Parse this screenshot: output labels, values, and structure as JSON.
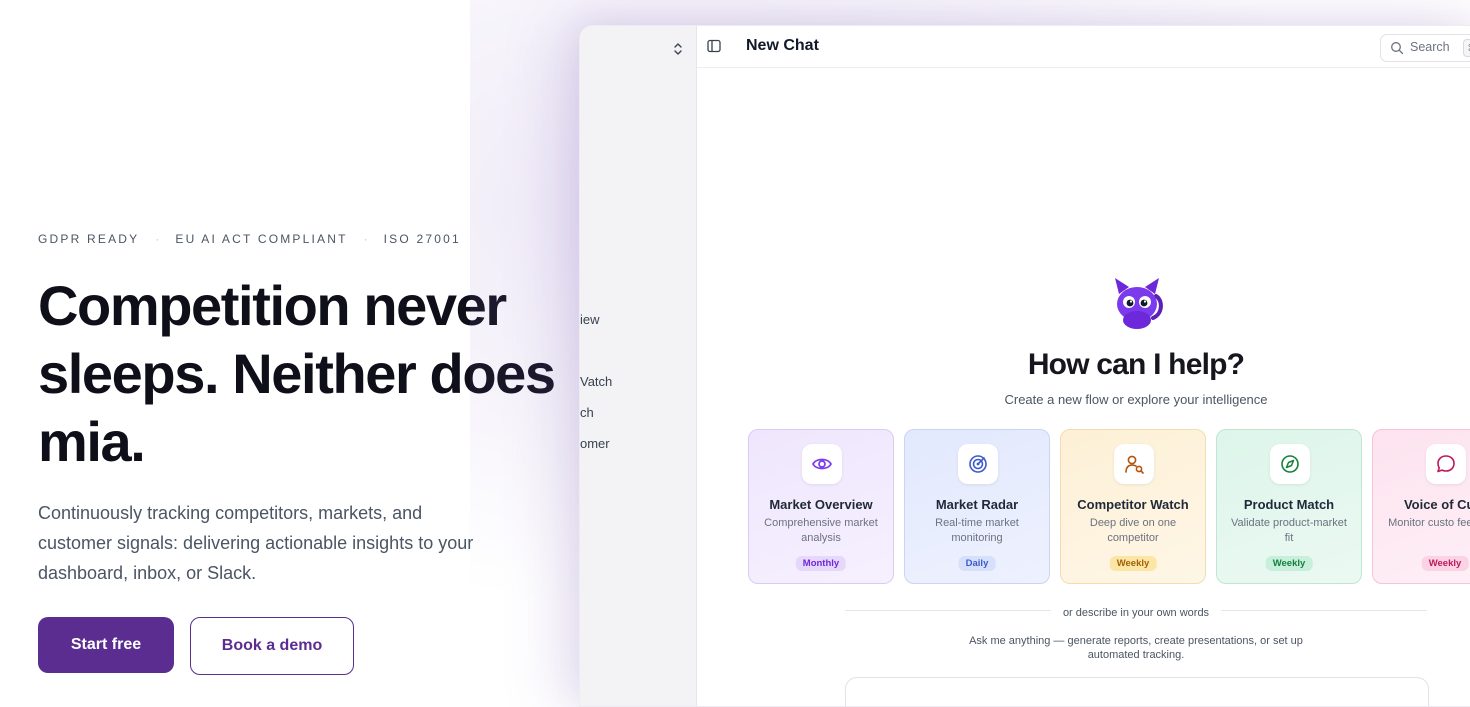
{
  "hero": {
    "badges": [
      "GDPR READY",
      "EU AI ACT COMPLIANT",
      "ISO 27001"
    ],
    "separator": "·",
    "headline": "Competition never sleeps. Neither does mia.",
    "subcopy": "Continuously tracking competitors, markets, and customer signals: delivering actionable insights to your dashboard, inbox, or Slack.",
    "primary_cta": "Start free",
    "secondary_cta": "Book a demo"
  },
  "app": {
    "sidebar": {
      "workspace_fragment": "",
      "items": [
        "iew",
        "",
        "Vatch",
        "ch",
        "omer"
      ]
    },
    "topbar": {
      "title": "New Chat",
      "search_label": "Search",
      "search_shortcut": "⌘"
    },
    "empty_state": {
      "title": "How can I help?",
      "subtitle": "Create a new flow or explore your intelligence"
    },
    "cards": [
      {
        "title": "Market Overview",
        "desc": "Comprehensive market analysis",
        "freq": "Monthly",
        "icon": "eye-icon",
        "color": "#7c3aed"
      },
      {
        "title": "Market Radar",
        "desc": "Real-time market monitoring",
        "freq": "Daily",
        "icon": "radar-icon",
        "color": "#3b5bcc"
      },
      {
        "title": "Competitor Watch",
        "desc": "Deep dive on one competitor",
        "freq": "Weekly",
        "icon": "user-search-icon",
        "color": "#b45309"
      },
      {
        "title": "Product Match",
        "desc": "Validate product-market fit",
        "freq": "Weekly",
        "icon": "compass-icon",
        "color": "#15803d"
      },
      {
        "title": "Voice of Cust",
        "desc": "Monitor custo feedback",
        "freq": "Weekly",
        "icon": "chat-bubble-icon",
        "color": "#be185d"
      }
    ],
    "divider_label": "or describe in your own words",
    "ask_hint": "Ask me anything — generate reports, create presentations, or set up automated tracking."
  },
  "colors": {
    "brand": "#5b2d91",
    "text": "#0f0f1a"
  }
}
